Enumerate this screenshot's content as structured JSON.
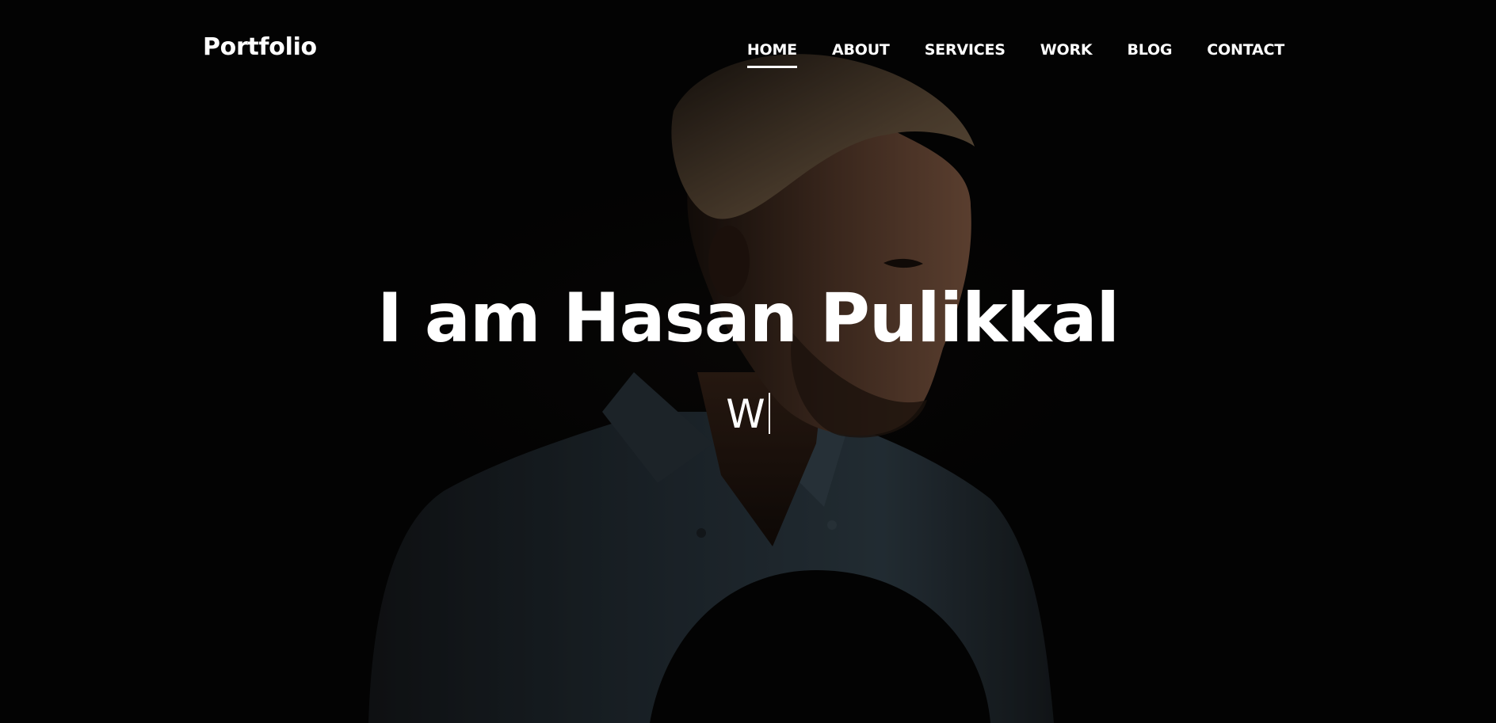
{
  "brand": {
    "name": "Portfolio"
  },
  "nav": {
    "items": [
      {
        "label": "HOME",
        "active": true
      },
      {
        "label": "ABOUT",
        "active": false
      },
      {
        "label": "SERVICES",
        "active": false
      },
      {
        "label": "WORK",
        "active": false
      },
      {
        "label": "BLOG",
        "active": false
      },
      {
        "label": "CONTACT",
        "active": false
      }
    ]
  },
  "hero": {
    "headline": "I am Hasan Pulikkal",
    "typed_text": "W",
    "background_image": "dark portrait of a man in a denim shirt holding a black hat"
  },
  "colors": {
    "background": "#050505",
    "text": "#ffffff"
  }
}
